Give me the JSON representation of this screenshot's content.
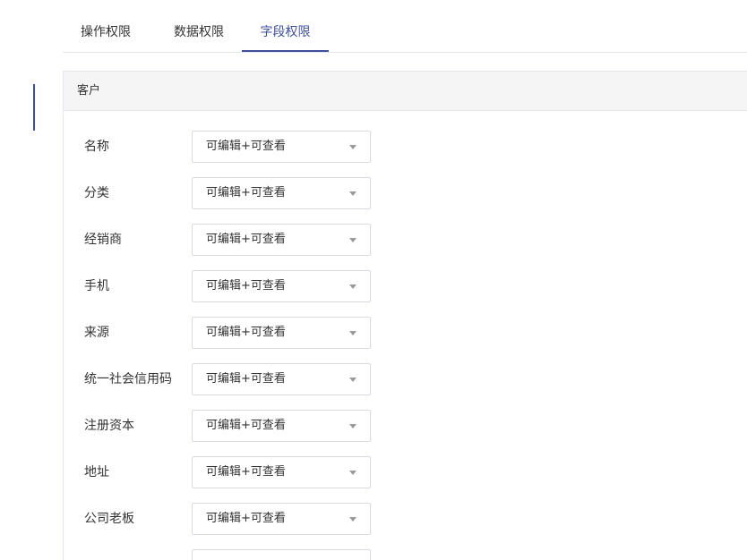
{
  "tabs": [
    {
      "label": "操作权限"
    },
    {
      "label": "数据权限"
    },
    {
      "label": "字段权限"
    }
  ],
  "active_tab": "字段权限",
  "accent_color": "#3f4f9b",
  "panel": {
    "title": "客户",
    "fields": [
      {
        "label": "名称",
        "value": "可编辑+可查看"
      },
      {
        "label": "分类",
        "value": "可编辑+可查看"
      },
      {
        "label": "经销商",
        "value": "可编辑+可查看"
      },
      {
        "label": "手机",
        "value": "可编辑+可查看"
      },
      {
        "label": "来源",
        "value": "可编辑+可查看"
      },
      {
        "label": "统一社会信用码",
        "value": "可编辑+可查看"
      },
      {
        "label": "注册资本",
        "value": "可编辑+可查看"
      },
      {
        "label": "地址",
        "value": "可编辑+可查看"
      },
      {
        "label": "公司老板",
        "value": "可编辑+可查看"
      },
      {
        "label": "",
        "value": ""
      }
    ]
  }
}
